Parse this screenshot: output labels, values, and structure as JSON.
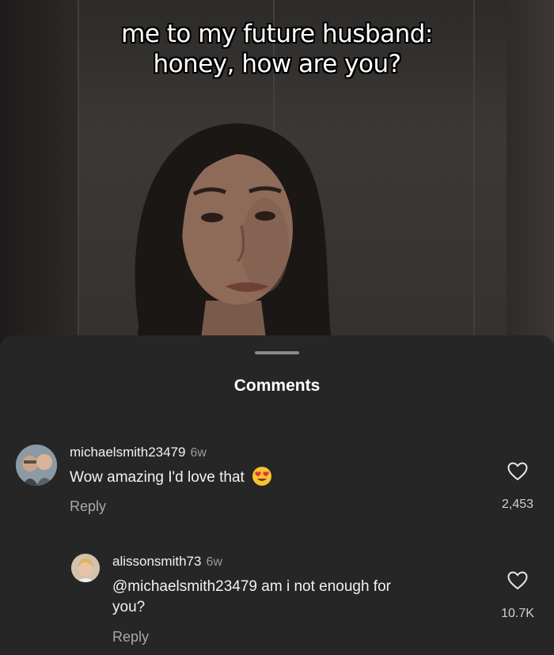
{
  "video": {
    "caption_line1": "me to my future husband:",
    "caption_line2": "honey, how are you?"
  },
  "comments_sheet": {
    "title": "Comments",
    "comments": [
      {
        "username": "michaelsmith23479",
        "time": "6w",
        "text": "Wow amazing I'd love that",
        "emoji": "heart-eyes-emoji",
        "reply_label": "Reply",
        "like_count": "2,453"
      },
      {
        "username": "alissonsmith73",
        "time": "6w",
        "text_line1": "@michaelsmith23479 am i not enough for",
        "text_line2": "you?",
        "reply_label": "Reply",
        "like_count": "10.7K"
      }
    ]
  },
  "colors": {
    "sheet_background": "#262626",
    "text_primary": "#f2f2f2",
    "text_secondary": "#9a9a9a"
  }
}
